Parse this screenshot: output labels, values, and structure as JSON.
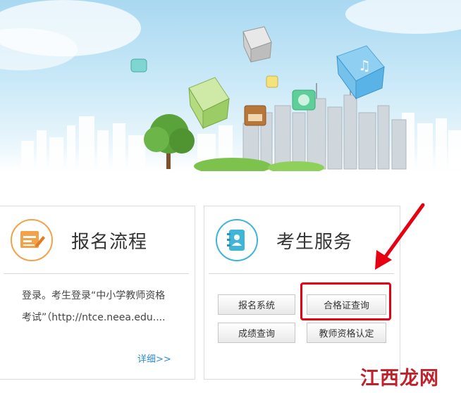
{
  "cards": {
    "signup": {
      "title": "报名流程",
      "icon": "form-icon",
      "desc_line1": "登录。考生登录“中小学教师资格",
      "desc_line2": "考试”（http://ntce.neea.edu....",
      "more": "详细>>"
    },
    "service": {
      "title": "考生服务",
      "icon": "contact-book-icon",
      "buttons": [
        "报名系统",
        "合格证查询",
        "成绩查询",
        "教师资格认定"
      ]
    }
  },
  "annotation": {
    "highlighted_button": "合格证查询",
    "color": "#e60012"
  },
  "watermark": {
    "text": "江西龙网"
  },
  "colors": {
    "signup_accent": "#f3a24a",
    "service_accent": "#3fb5d8",
    "link": "#2b8bd4"
  }
}
